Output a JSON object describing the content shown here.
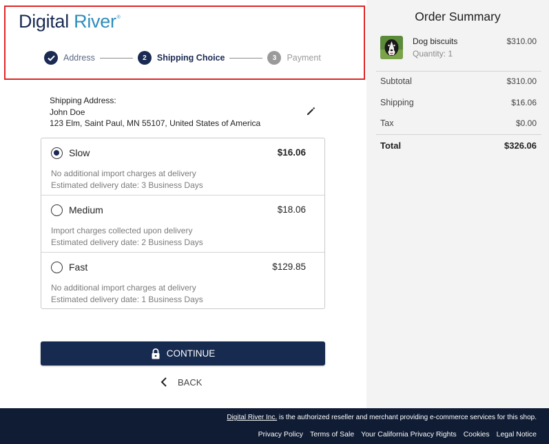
{
  "brand": {
    "part1": "Digital",
    "part2": "River",
    "reg": "®"
  },
  "steps": [
    {
      "label": "Address",
      "state": "done",
      "num": ""
    },
    {
      "label": "Shipping Choice",
      "state": "active",
      "num": "2"
    },
    {
      "label": "Payment",
      "state": "todo",
      "num": "3"
    }
  ],
  "shipping_address": {
    "heading": "Shipping Address:",
    "name": "John Doe",
    "line": "123 Elm, Saint Paul, MN 55107, United States of America"
  },
  "shipping_options": [
    {
      "name": "Slow",
      "price": "$16.06",
      "desc1": "No additional import charges at delivery",
      "desc2": "Estimated delivery date: 3 Business Days",
      "selected": true
    },
    {
      "name": "Medium",
      "price": "$18.06",
      "desc1": "Import charges collected upon delivery",
      "desc2": "Estimated delivery date: 2 Business Days",
      "selected": false
    },
    {
      "name": "Fast",
      "price": "$129.85",
      "desc1": "No additional import charges at delivery",
      "desc2": "Estimated delivery date: 1 Business Days",
      "selected": false
    }
  ],
  "actions": {
    "continue_label": "CONTINUE",
    "back_label": "BACK"
  },
  "order_summary": {
    "title": "Order Summary",
    "product": {
      "name": "Dog biscuits",
      "quantity": "Quantity: 1",
      "price": "$310.00"
    },
    "subtotal_label": "Subtotal",
    "subtotal": "$310.00",
    "shipping_label": "Shipping",
    "shipping": "$16.06",
    "tax_label": "Tax",
    "tax": "$0.00",
    "total_label": "Total",
    "total": "$326.06"
  },
  "footer": {
    "reseller_link": "Digital River Inc.",
    "reseller_text": " is the authorized reseller and merchant providing e-commerce services for this shop.",
    "links": [
      "Privacy Policy",
      "Terms of Sale",
      "Your California Privacy Rights",
      "Cookies",
      "Legal Notice"
    ]
  },
  "colors": {
    "navy": "#172a4f",
    "brand_blue": "#2f8dbc",
    "highlight_border": "#e02424",
    "footer_bg": "#0f1c33"
  }
}
